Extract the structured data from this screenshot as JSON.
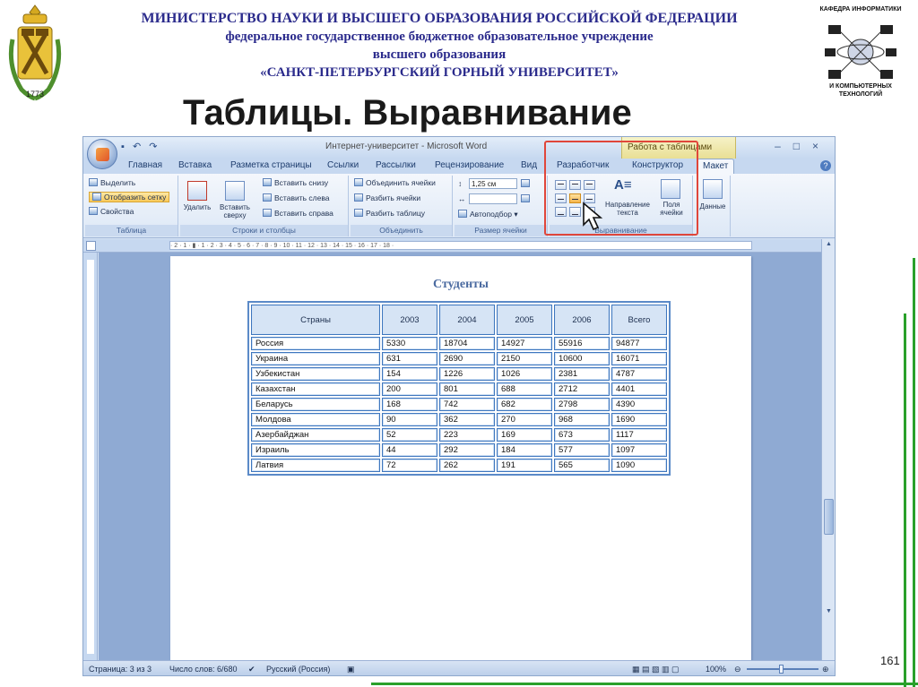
{
  "header": {
    "line1": "МИНИСТЕРСТВО НАУКИ И ВЫСШЕГО ОБРАЗОВАНИЯ РОССИЙСКОЙ ФЕДЕРАЦИИ",
    "line2": "федеральное государственное бюджетное образовательное учреждение",
    "line3": "высшего образования",
    "line4": "«САНКТ-ПЕТЕРБУРГСКИЙ ГОРНЫЙ УНИВЕРСИТЕТ»"
  },
  "crest": {
    "year": "1773"
  },
  "dept": {
    "top": "КАФЕДРА ИНФОРМАТИКИ",
    "bottom": "И КОМПЬЮТЕРНЫХ ТЕХНОЛОГИЙ"
  },
  "slide_title": "Таблицы. Выравнивание",
  "page_number": "161",
  "word": {
    "window_title": "Интернет-университет - Microsoft Word",
    "context_tools": "Работа с таблицами",
    "tabs": [
      "Главная",
      "Вставка",
      "Разметка страницы",
      "Ссылки",
      "Рассылки",
      "Рецензирование",
      "Вид",
      "Разработчик",
      "Конструктор",
      "Макет"
    ],
    "ribbon": {
      "table_group": {
        "label": "Таблица",
        "select": "Выделить",
        "show_grid": "Отобразить сетку",
        "properties": "Свойства"
      },
      "rows_group": {
        "label": "Строки и столбцы",
        "delete": "Удалить",
        "insert_above": "Вставить сверху",
        "insert_below": "Вставить снизу",
        "insert_left": "Вставить слева",
        "insert_right": "Вставить справа"
      },
      "merge_group": {
        "label": "Объединить",
        "merge": "Объединить ячейки",
        "split_cells": "Разбить ячейки",
        "split_table": "Разбить таблицу"
      },
      "size_group": {
        "label": "Размер ячейки",
        "height": "1,25 см",
        "autofit": "Автоподбор"
      },
      "align_group": {
        "label": "Выравнивание",
        "direction": "Направление текста",
        "margins": "Поля ячейки"
      },
      "data_group": {
        "label": "Данные"
      }
    },
    "ruler_text": "· 2 · 1 · ▮ · 1 · 2 · 3 · 4 · 5 · 6 · 7 · 8 · 9 · 10 · 11 · 12 · 13 · 14 · 15 · 16 · 17 · 18 ·",
    "status": {
      "page": "Страница: 3 из 3",
      "words": "Число слов: 6/680",
      "language": "Русский (Россия)",
      "zoom": "100%"
    }
  },
  "doc": {
    "title": "Студенты",
    "headers": [
      "Страны",
      "2003",
      "2004",
      "2005",
      "2006",
      "Всего"
    ],
    "rows": [
      [
        "Россия",
        "5330",
        "18704",
        "14927",
        "55916",
        "94877"
      ],
      [
        "Украина",
        "631",
        "2690",
        "2150",
        "10600",
        "16071"
      ],
      [
        "Узбекистан",
        "154",
        "1226",
        "1026",
        "2381",
        "4787"
      ],
      [
        "Казахстан",
        "200",
        "801",
        "688",
        "2712",
        "4401"
      ],
      [
        "Беларусь",
        "168",
        "742",
        "682",
        "2798",
        "4390"
      ],
      [
        "Молдова",
        "90",
        "362",
        "270",
        "968",
        "1690"
      ],
      [
        "Азербайджан",
        "52",
        "223",
        "169",
        "673",
        "1117"
      ],
      [
        "Израиль",
        "44",
        "292",
        "184",
        "577",
        "1097"
      ],
      [
        "Латвия",
        "72",
        "262",
        "191",
        "565",
        "1090"
      ]
    ]
  },
  "colors": {
    "header_text": "#2b2b8c",
    "accent_green": "#2aa02a",
    "highlight_red": "#e0463a"
  },
  "icons": [
    "crest-icon",
    "network-icon",
    "office-button-icon",
    "cursor-icon"
  ]
}
